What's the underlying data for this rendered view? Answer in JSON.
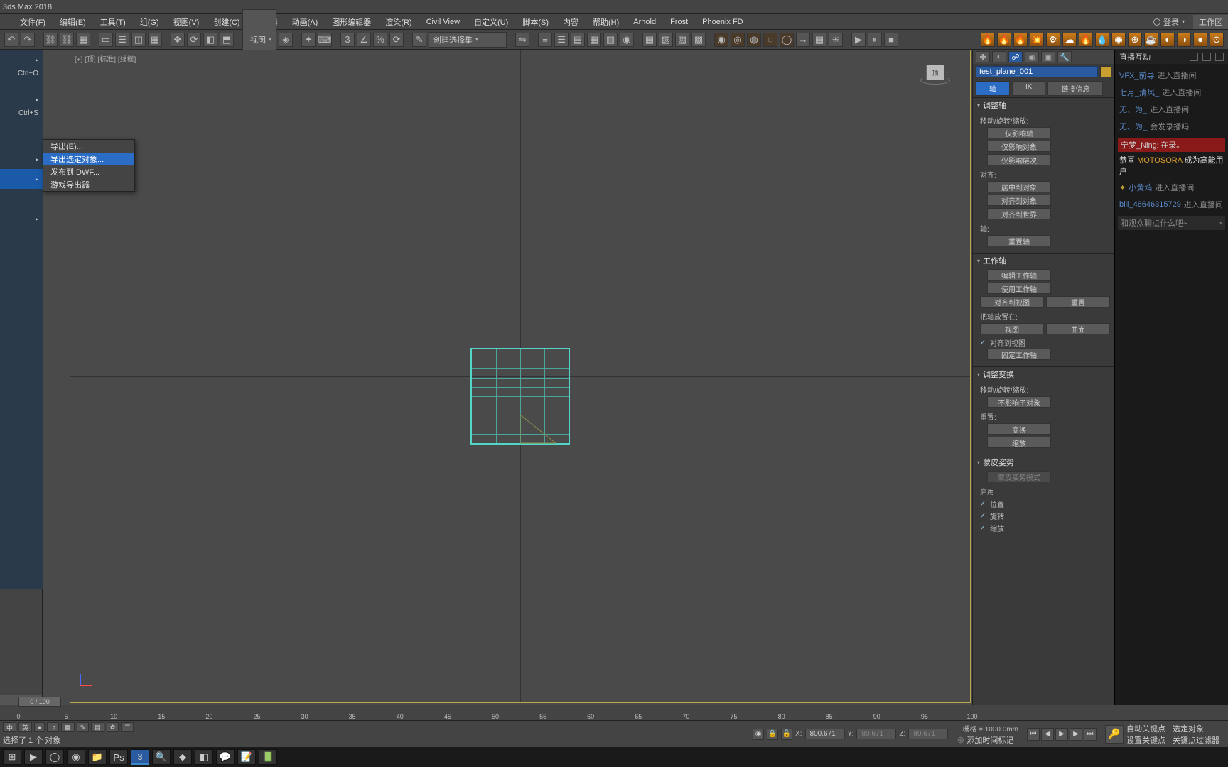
{
  "app_title": "3ds Max 2018",
  "menu": [
    "文件(F)",
    "编辑(E)",
    "工具(T)",
    "组(G)",
    "视图(V)",
    "创建(C)",
    "修改器",
    "动画(A)",
    "图形编辑器",
    "渲染(R)",
    "Civil View",
    "自定义(U)",
    "脚本(S)",
    "内容",
    "帮助(H)",
    "Arnold",
    "Frost",
    "Phoenix FD"
  ],
  "login": {
    "label": "登录",
    "workspace": "工作区"
  },
  "toolbar": {
    "selection_set": "创建选择集"
  },
  "left_shortcuts": [
    "Ctrl+O",
    "Ctrl+S"
  ],
  "submenu": {
    "items": [
      "导出(E)...",
      "导出选定对象...",
      "发布到 DWF...",
      "游戏导出器"
    ],
    "highlight_index": 1
  },
  "viewport": {
    "labels": "[+] [顶] [标准] [线框]",
    "viewcube_face": "顶"
  },
  "command_panel": {
    "object_name": "test_plane_001",
    "pill_tabs": [
      "轴",
      "IK",
      "链接信息"
    ],
    "pill_active": 0,
    "rollouts": {
      "adjust_axis": {
        "title": "调整轴",
        "group1_label": "移动/旋转/缩放:",
        "buttons1": [
          "仅影响轴",
          "仅影响对象",
          "仅影响层次"
        ],
        "align_label": "对齐:",
        "buttons2": [
          "居中到对象",
          "对齐到对象",
          "对齐到世界"
        ],
        "pivot_label": "轴:",
        "reset_pivot": "重置轴"
      },
      "working_pivot": {
        "title": "工作轴",
        "edit": "编辑工作轴",
        "use": "使用工作轴",
        "row_btns": [
          "对齐到视图",
          "重置"
        ],
        "place_label": "把轴放置在:",
        "row_btns2": [
          "视图",
          "曲面"
        ],
        "chk_align_view": "对齐到视图",
        "pin": "固定工作轴"
      },
      "adjust_xform": {
        "title": "调整变换",
        "group_label": "移动/旋转/缩放:",
        "btn1": "不影响子对象",
        "reset_label": "重置:",
        "btns": [
          "变换",
          "缩放"
        ]
      },
      "skin_pose": {
        "title": "蒙皮姿势",
        "mode": "蒙皮姿势模式",
        "enable_label": "启用",
        "chks": [
          "位置",
          "旋转",
          "缩放"
        ]
      }
    }
  },
  "chat": {
    "header": "直播互动",
    "lines": [
      {
        "name": "VFX_前导",
        "txt": "进入直播间"
      },
      {
        "name": "七月_清风_",
        "txt": "进入直播间"
      },
      {
        "name": "无、为_",
        "txt": "进入直播间"
      },
      {
        "name": "无、为_",
        "txt": "会发录播吗"
      }
    ],
    "banner": {
      "name": "宁梦_Ning",
      "txt": "在录。"
    },
    "moto": {
      "pre": "恭喜",
      "mid": "MOTOSORA",
      "suf": "成为高能用户"
    },
    "lines2": [
      {
        "name": "小黄鸡",
        "txt": "进入直播间"
      },
      {
        "name": "bili_46646315729",
        "txt": "进入直播间"
      }
    ],
    "fold": "和观众聊点什么吧~"
  },
  "timeline": {
    "slider_label": "0 / 100",
    "ticks": [
      0,
      5,
      10,
      15,
      20,
      25,
      30,
      35,
      40,
      45,
      50,
      55,
      60,
      65,
      70,
      75,
      80,
      85,
      90,
      95,
      100
    ]
  },
  "status": {
    "lang_items": [
      "中",
      "英",
      "●",
      "♫",
      "▦",
      "✎",
      "▤",
      "✿",
      "☰"
    ],
    "x_label": "X:",
    "x_val": "800.671",
    "y_label": "Y:",
    "y_val": "80.671",
    "z_label": "Z:",
    "z_val": "80.671",
    "grid_label": "栅格 = 1000.0mm",
    "add_time_mark": "添加时间标记",
    "right_top": [
      "自动关键点",
      "选定对象"
    ],
    "right_bot": [
      "设置关键点",
      "关键点过滤器"
    ],
    "bottom_hint": "选择了 1 个 对象",
    "lock_icons": true
  },
  "taskbar": {
    "items": [
      "⊞",
      "▶",
      "◯",
      "◉",
      "📁",
      "Ps",
      "3",
      "🔍",
      "◆",
      "◧",
      "💬",
      "📝",
      "📗"
    ]
  }
}
